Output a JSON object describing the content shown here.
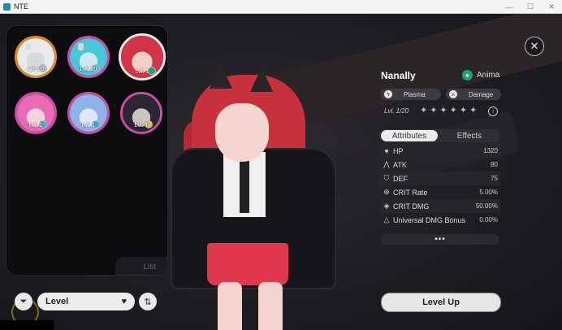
{
  "window": {
    "title": "NTE",
    "controls": [
      "—",
      "☐",
      "✕"
    ]
  },
  "roster": {
    "cards": [
      {
        "level": "Lvl. 20",
        "ring": "#e28a1d",
        "face": "#d8d8de",
        "hair": "#e9e9ee",
        "elem": "#bdbdbd"
      },
      {
        "level": "Lvl. 20",
        "ring": "#c94ea6",
        "face": "#cde8ef",
        "hair": "#4bc6d6",
        "elem": "#5ac6d6"
      },
      {
        "level": "Lvl. 1",
        "ring": "#e9e9e9",
        "face": "#f1d0c8",
        "hair": "#d33447",
        "elem": "#17a37e"
      },
      {
        "level": "Lvl. 1",
        "ring": "#c94ea6",
        "face": "#f4d2dc",
        "hair": "#e86bb6",
        "elem": "#4aa5d8"
      },
      {
        "level": "Lvl. 1",
        "ring": "#c94ea6",
        "face": "#dfe6f5",
        "hair": "#8fb2e8",
        "elem": "#4aa5d8"
      },
      {
        "level": "Lvl. 1",
        "ring": "#c94ea6",
        "face": "#ccc3c4",
        "hair": "#2b2630",
        "elem": "#e0c04a"
      }
    ],
    "list_label": "List"
  },
  "controls": {
    "level_select": "Level"
  },
  "character": {
    "name": "Nanally",
    "faction": "Anima",
    "element": "Plasma",
    "role": "Damage",
    "level": "Lvl. 1/20",
    "stars": "✦✦✦✦✦✦"
  },
  "tabs": {
    "attributes": "Attributes",
    "effects": "Effects"
  },
  "stats": [
    {
      "icon": "♥",
      "name": "HP",
      "value": "1320"
    },
    {
      "icon": "⋀",
      "name": "ATK",
      "value": "80"
    },
    {
      "icon": "⛉",
      "name": "DEF",
      "value": "75"
    },
    {
      "icon": "⊕",
      "name": "CRIT Rate",
      "value": "5.00%"
    },
    {
      "icon": "◈",
      "name": "CRIT DMG",
      "value": "50.00%"
    },
    {
      "icon": "△",
      "name": "Universal DMG Bonus",
      "value": "0.00%"
    }
  ],
  "more": "•••",
  "level_up": "Level Up"
}
